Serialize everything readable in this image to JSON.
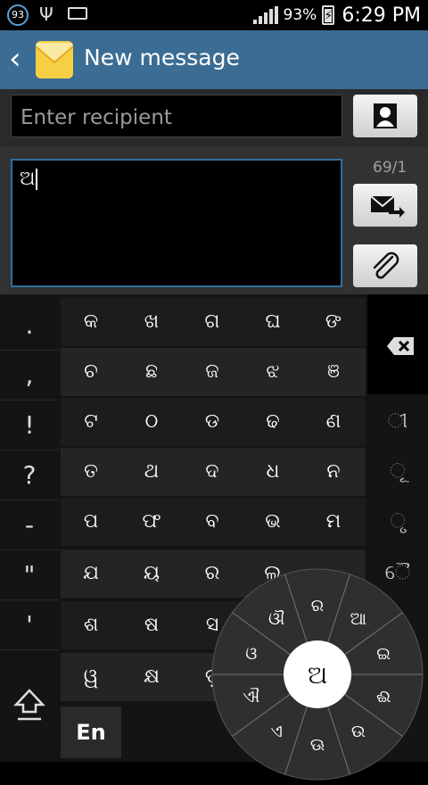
{
  "status_bar": {
    "notification_count": "93",
    "usb_icon": "usb-icon",
    "keyboard_icon": "keyboard-icon",
    "battery": "93%",
    "time": "6:29 PM"
  },
  "action_bar": {
    "back_icon": "chevron-left-icon",
    "app_icon": "envelope-icon",
    "title": "New message"
  },
  "recipient": {
    "placeholder": "Enter recipient",
    "contact_icon": "contact-icon"
  },
  "compose": {
    "text": "ଅ",
    "char_count": "69/1",
    "send_icon": "send-icon",
    "attach_icon": "paperclip-icon"
  },
  "keyboard": {
    "punctuation": [
      ".",
      ",",
      "!",
      "?",
      "-",
      "\"",
      "'"
    ],
    "rows": [
      [
        "କ",
        "ଖ",
        "ଗ",
        "ଘ",
        "ଙ"
      ],
      [
        "ଚ",
        "ଛ",
        "ଜ",
        "ଝ",
        "ଞ"
      ],
      [
        "ଟ",
        "ଠ",
        "ଡ",
        "ଢ",
        "ଣ"
      ],
      [
        "ତ",
        "ଥ",
        "ଦ",
        "ଧ",
        "ନ"
      ],
      [
        "ପ",
        "ଫ",
        "ବ",
        "ଭ",
        "ମ"
      ],
      [
        "ଯ",
        "ୟ",
        "ର",
        "ଲ",
        ""
      ],
      [
        "ଶ",
        "ଷ",
        "ସ",
        "",
        ""
      ],
      [
        "ୱ",
        "କ୍ଷ",
        "ଡ଼",
        "",
        ""
      ]
    ],
    "right_keys": [
      "backspace-icon",
      "",
      "ୀ",
      "ୂ",
      "ୃ",
      "ୈ"
    ],
    "language": "En",
    "shift_icon": "shift-icon",
    "radial": {
      "center": "ଅ",
      "options": [
        "ର",
        "ଆ",
        "ଇ",
        "ଈ",
        "ଉ",
        "ଊ",
        "ଏ",
        "ଐ",
        "ଓ",
        "ଔ"
      ]
    }
  }
}
